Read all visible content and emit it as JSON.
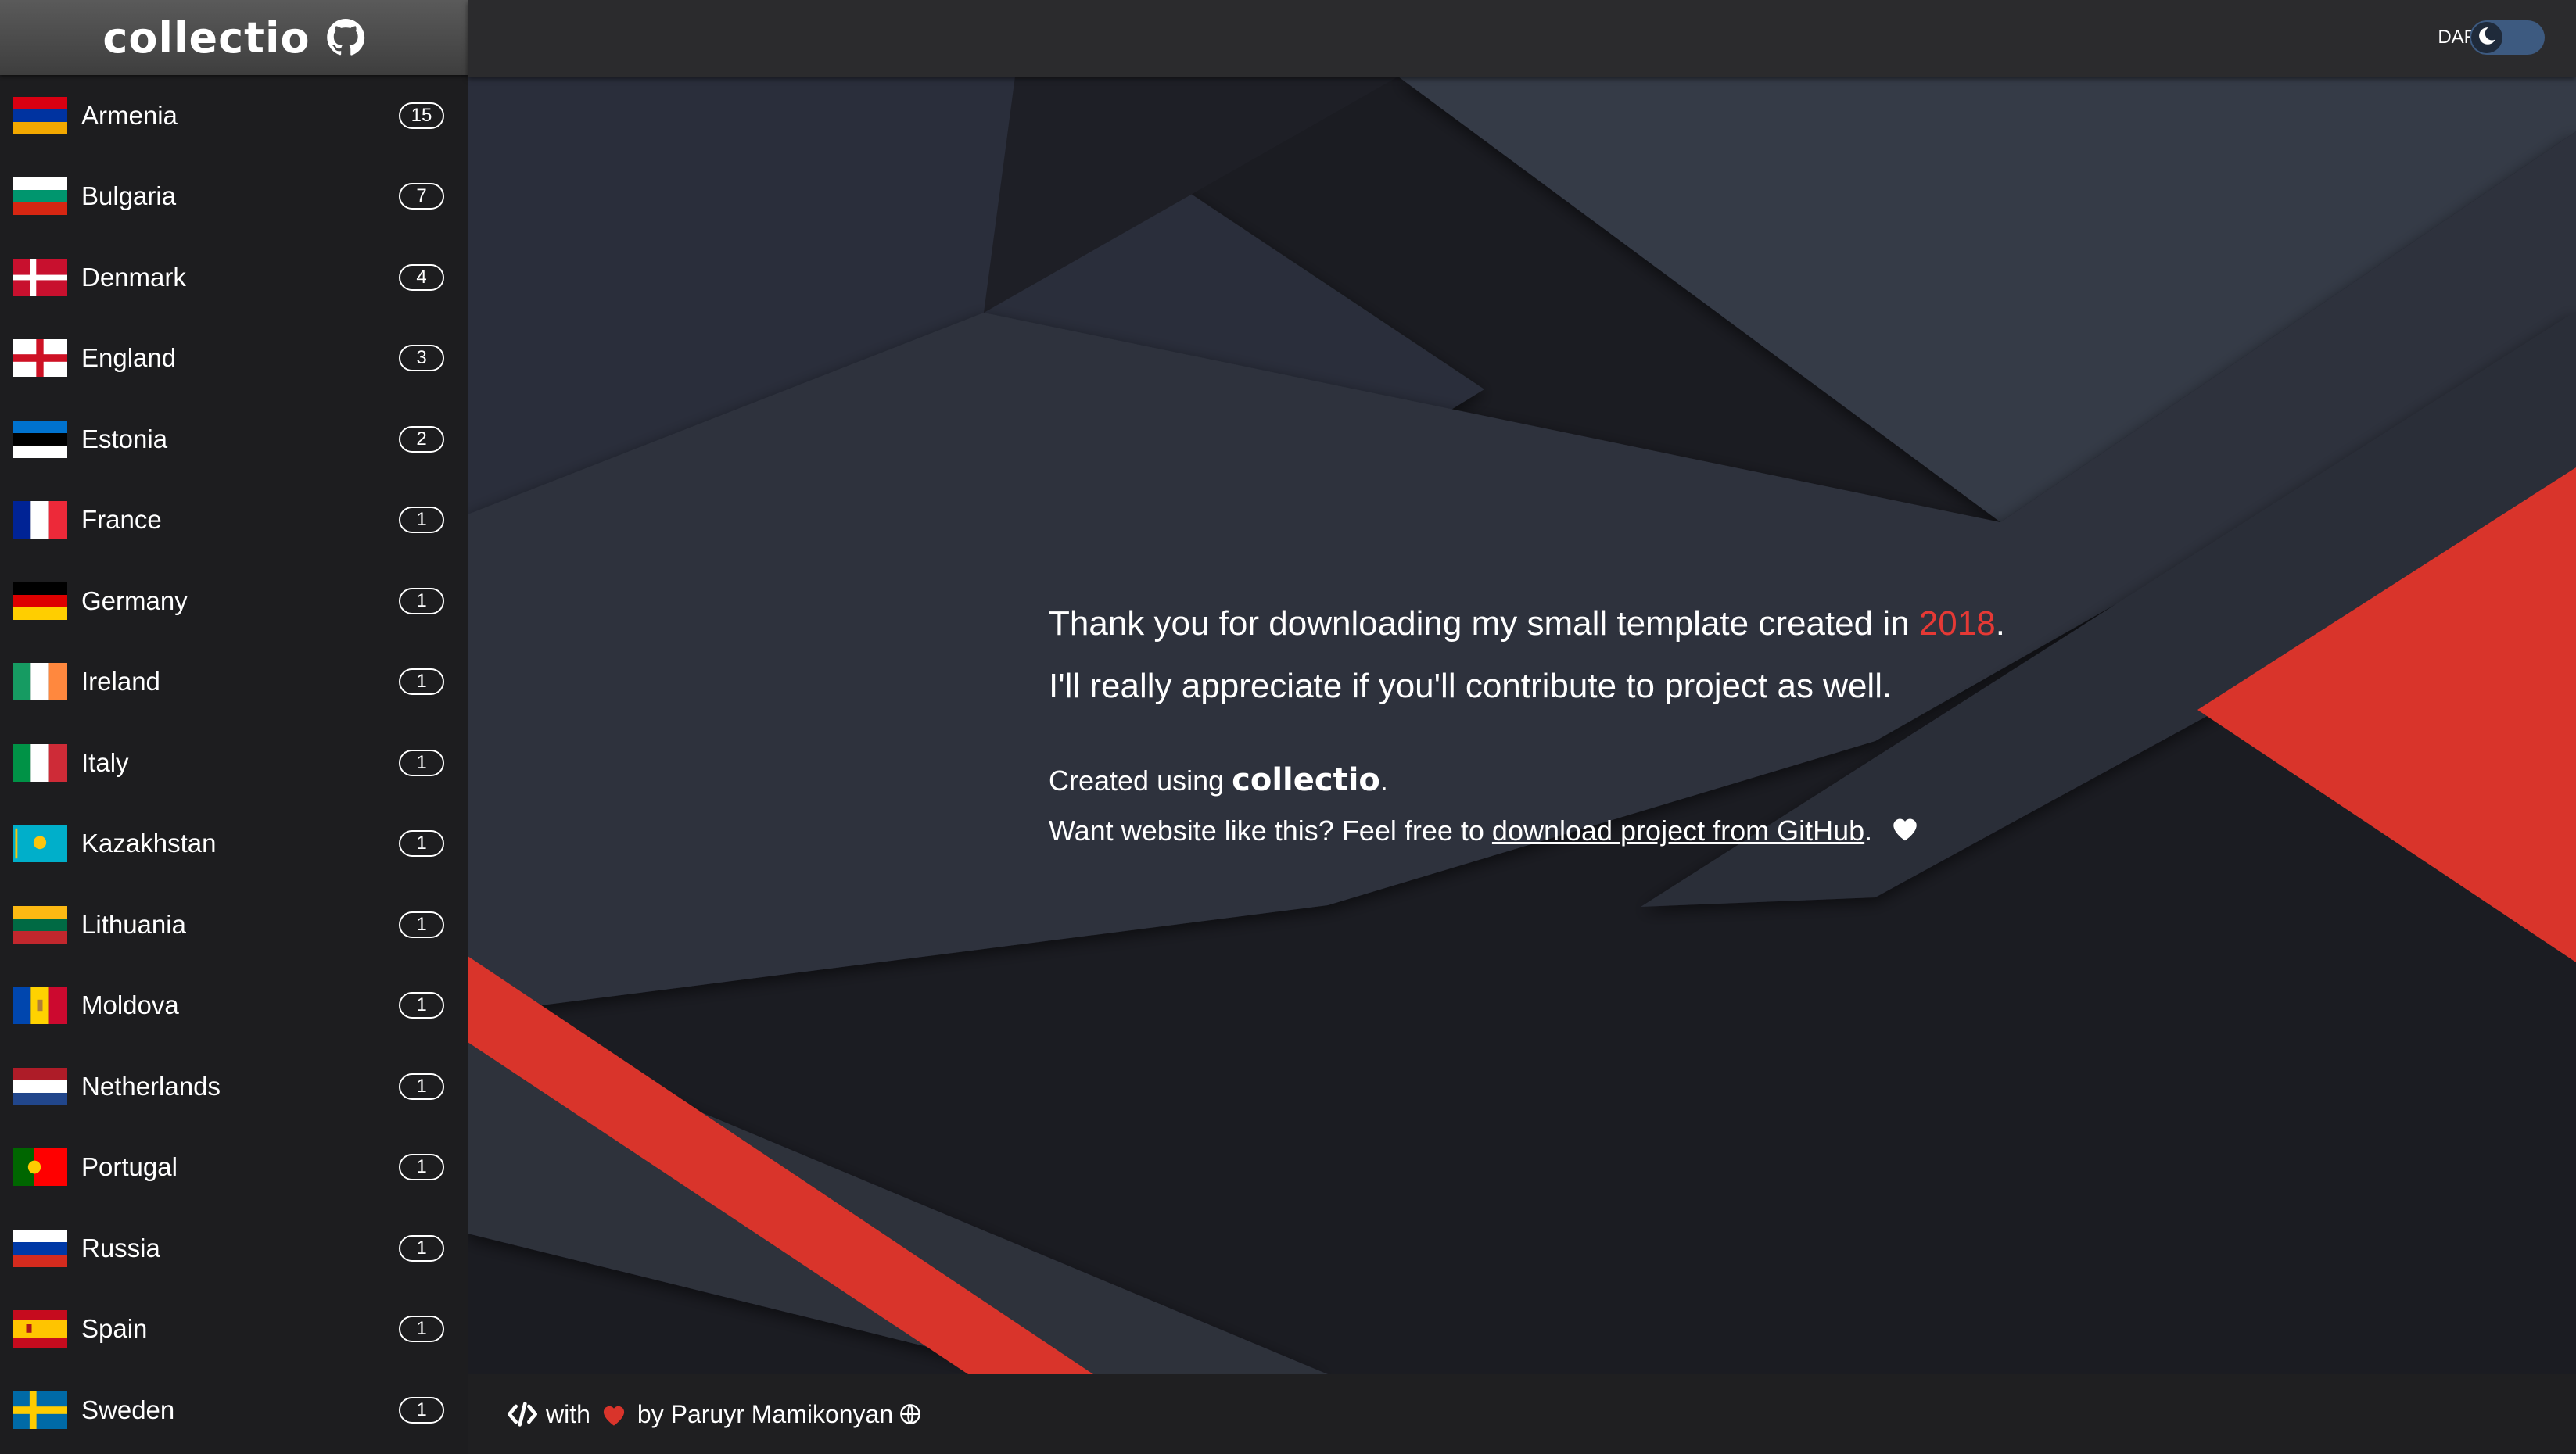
{
  "app": {
    "title": "collectio"
  },
  "theme": {
    "label": "DARK"
  },
  "countries": [
    {
      "name": "Armenia",
      "count": "15"
    },
    {
      "name": "Bulgaria",
      "count": "7"
    },
    {
      "name": "Denmark",
      "count": "4"
    },
    {
      "name": "England",
      "count": "3"
    },
    {
      "name": "Estonia",
      "count": "2"
    },
    {
      "name": "France",
      "count": "1"
    },
    {
      "name": "Germany",
      "count": "1"
    },
    {
      "name": "Ireland",
      "count": "1"
    },
    {
      "name": "Italy",
      "count": "1"
    },
    {
      "name": "Kazakhstan",
      "count": "1"
    },
    {
      "name": "Lithuania",
      "count": "1"
    },
    {
      "name": "Moldova",
      "count": "1"
    },
    {
      "name": "Netherlands",
      "count": "1"
    },
    {
      "name": "Portugal",
      "count": "1"
    },
    {
      "name": "Russia",
      "count": "1"
    },
    {
      "name": "Spain",
      "count": "1"
    },
    {
      "name": "Sweden",
      "count": "1"
    }
  ],
  "main": {
    "line1_pre": "Thank you for downloading my small template created in ",
    "line1_year": "2018",
    "line1_post": ".",
    "line2": "I'll really appreciate if you'll contribute to project as well.",
    "created_pre": "Created using ",
    "created_brand": "collectio",
    "created_post": ".",
    "want_pre": "Want website like this? Feel free to ",
    "want_link": "download project from GitHub",
    "want_post": "."
  },
  "footer": {
    "with": "with",
    "by": "by Paruyr Mamikonyan"
  },
  "colors": {
    "accent": "#d9342b",
    "background": "#1b1c22",
    "sidebar": "#1d1d1f"
  }
}
